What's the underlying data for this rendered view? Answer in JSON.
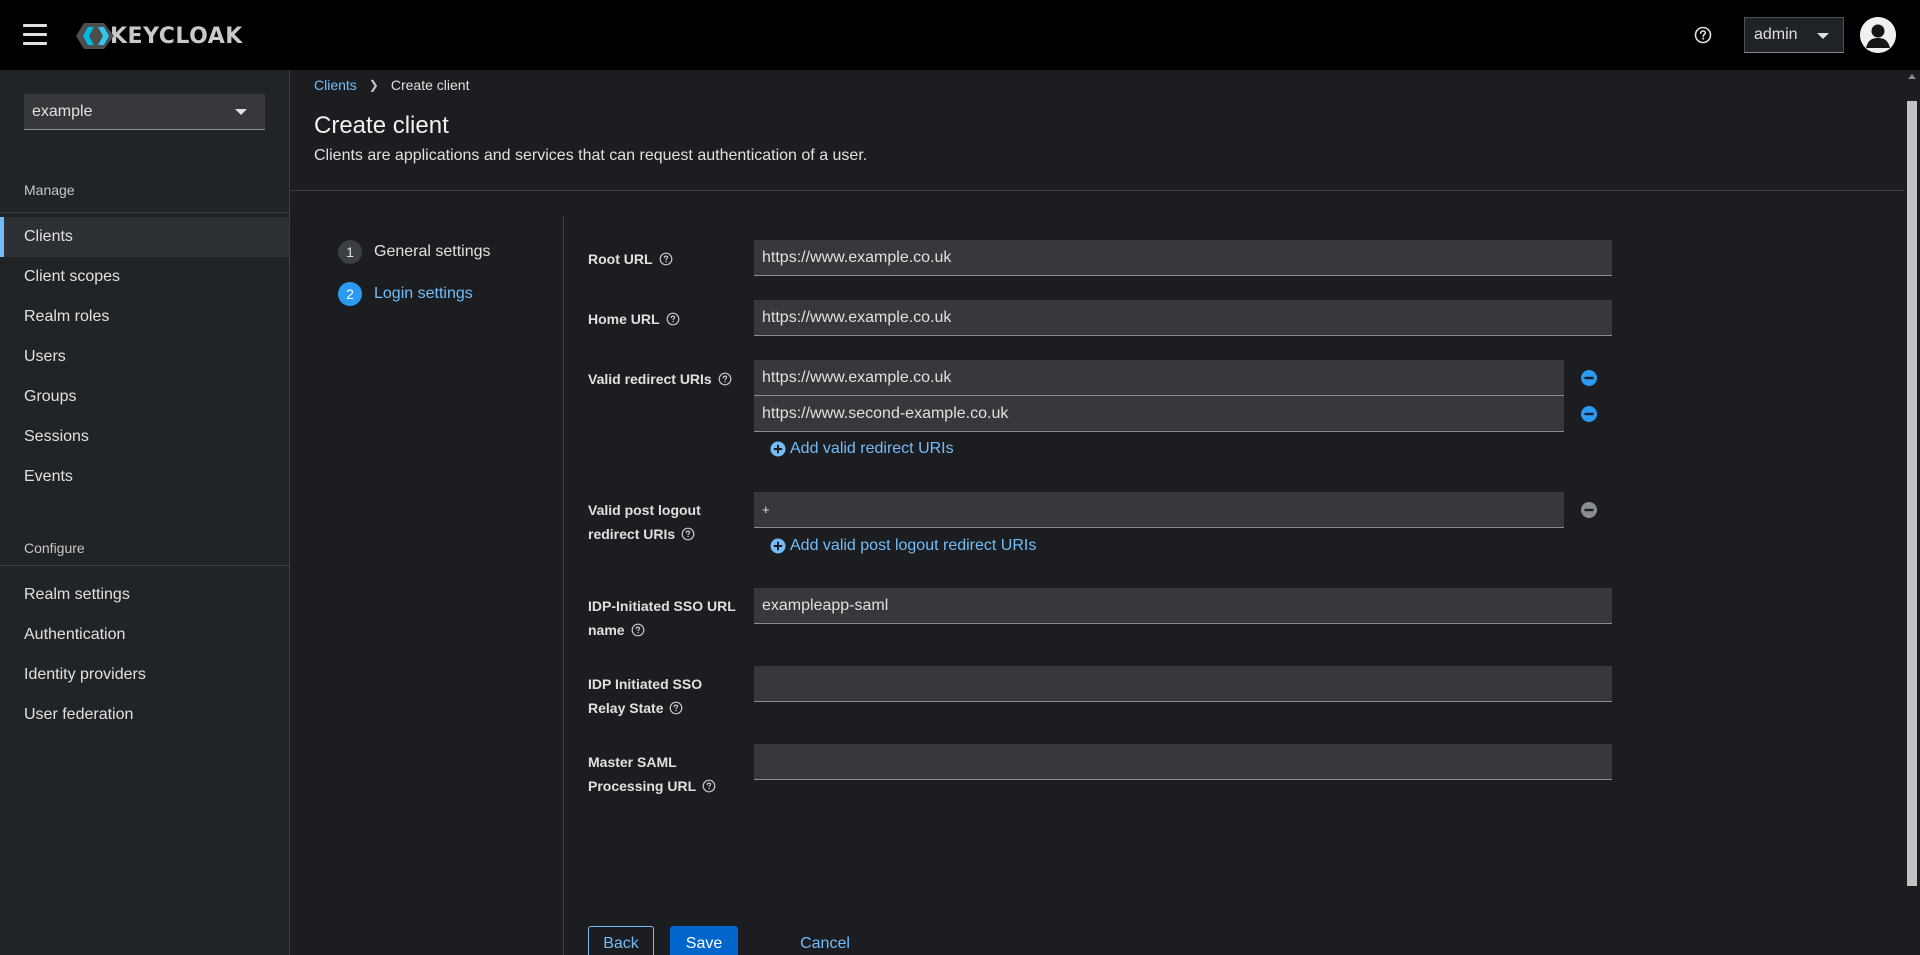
{
  "header": {
    "logo_text": "KEYCLOAK",
    "user_name": "admin"
  },
  "sidebar": {
    "realm": "example",
    "sections": [
      {
        "title": "Manage",
        "items": [
          "Clients",
          "Client scopes",
          "Realm roles",
          "Users",
          "Groups",
          "Sessions",
          "Events"
        ]
      },
      {
        "title": "Configure",
        "items": [
          "Realm settings",
          "Authentication",
          "Identity providers",
          "User federation"
        ]
      }
    ],
    "active_item": "Clients"
  },
  "breadcrumb": {
    "parent": "Clients",
    "current": "Create client"
  },
  "page": {
    "title": "Create client",
    "description": "Clients are applications and services that can request authentication of a user."
  },
  "wizard": {
    "steps": [
      {
        "number": "1",
        "label": "General settings"
      },
      {
        "number": "2",
        "label": "Login settings"
      }
    ],
    "active_step": 2
  },
  "form": {
    "root_url": {
      "label": "Root URL",
      "value": "https://www.example.co.uk"
    },
    "home_url": {
      "label": "Home URL",
      "value": "https://www.example.co.uk"
    },
    "valid_redirect_uris": {
      "label": "Valid redirect URIs",
      "values": [
        "https://www.example.co.uk",
        "https://www.second-example.co.uk"
      ],
      "add_label": "Add valid redirect URIs"
    },
    "valid_post_logout": {
      "label_line1": "Valid post logout",
      "label_line2": "redirect URIs",
      "values": [
        "+"
      ],
      "add_label": "Add valid post logout redirect URIs"
    },
    "idp_sso_url_name": {
      "label_line1": "IDP-Initiated SSO URL",
      "label_line2": "name",
      "value": "exampleapp-saml"
    },
    "idp_relay_state": {
      "label_line1": "IDP Initiated SSO",
      "label_line2": "Relay State",
      "value": ""
    },
    "master_saml_url": {
      "label_line1": "Master SAML",
      "label_line2": "Processing URL",
      "value": ""
    }
  },
  "actions": {
    "back": "Back",
    "save": "Save",
    "cancel": "Cancel"
  },
  "colors": {
    "accent": "#73bcf7",
    "primary_button": "#0066cc",
    "remove_icon_active": "#2b9af3",
    "remove_icon_disabled": "#8a8d90"
  }
}
